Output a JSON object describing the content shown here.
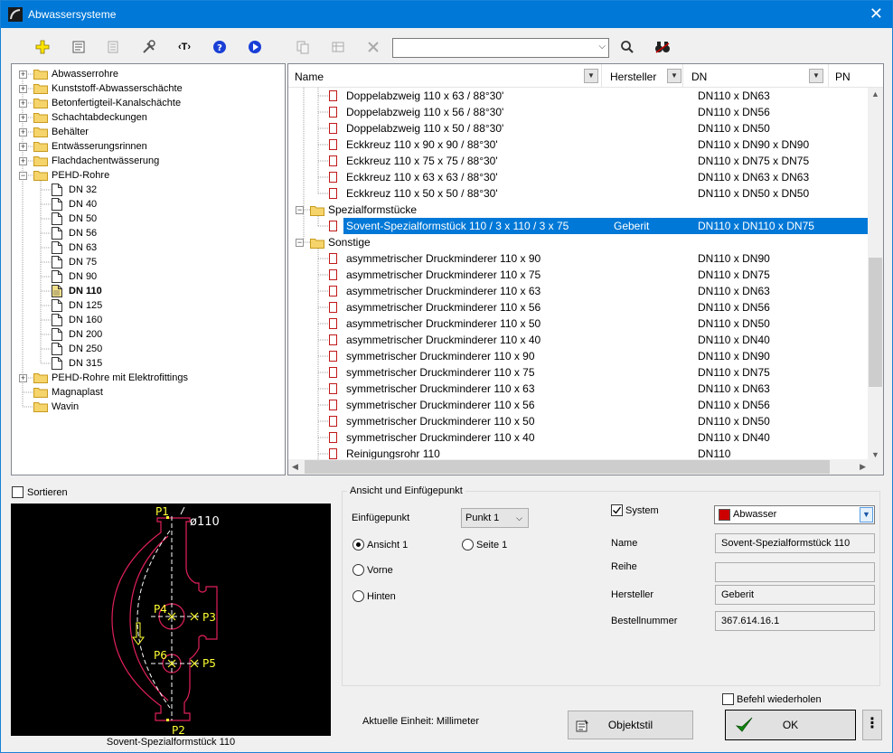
{
  "window": {
    "title": "Abwassersysteme",
    "close_icon": "close-icon"
  },
  "toolbar": {
    "search_value": "",
    "icons": [
      "add-icon",
      "properties-icon",
      "document-icon",
      "tools-icon",
      "text-tag-icon",
      "help-icon",
      "play-icon",
      "copy-icon",
      "table-icon",
      "delete-icon",
      "search-icon",
      "binoculars-icon"
    ]
  },
  "tree": {
    "items": [
      {
        "label": "Abwasserrohre"
      },
      {
        "label": "Kunststoff-Abwasserschächte"
      },
      {
        "label": "Betonfertigteil-Kanalschächte"
      },
      {
        "label": "Schachtabdeckungen"
      },
      {
        "label": "Behälter"
      },
      {
        "label": "Entwässerungsrinnen"
      },
      {
        "label": "Flachdachentwässerung"
      },
      {
        "label": "PEHD-Rohre"
      },
      {
        "label": "DN 32"
      },
      {
        "label": "DN 40"
      },
      {
        "label": "DN 50"
      },
      {
        "label": "DN 56"
      },
      {
        "label": "DN 63"
      },
      {
        "label": "DN 75"
      },
      {
        "label": "DN 90"
      },
      {
        "label": "DN 110"
      },
      {
        "label": "DN 125"
      },
      {
        "label": "DN 160"
      },
      {
        "label": "DN 200"
      },
      {
        "label": "DN 250"
      },
      {
        "label": "DN 315"
      },
      {
        "label": "PEHD-Rohre mit Elektrofittings"
      },
      {
        "label": "Magnaplast"
      },
      {
        "label": "Wavin"
      }
    ]
  },
  "grid": {
    "columns": [
      "Name",
      "Hersteller",
      "DN",
      "PN"
    ],
    "rows": [
      {
        "name": "Doppelabzweig 110 x 63 / 88°30'",
        "hersteller": "",
        "dn": "DN110 x DN63"
      },
      {
        "name": "Doppelabzweig 110 x 56 / 88°30'",
        "hersteller": "",
        "dn": "DN110 x DN56"
      },
      {
        "name": "Doppelabzweig 110 x 50 / 88°30'",
        "hersteller": "",
        "dn": "DN110 x DN50"
      },
      {
        "name": "Eckkreuz 110 x 90 x 90 / 88°30'",
        "hersteller": "",
        "dn": "DN110 x DN90 x DN90"
      },
      {
        "name": "Eckkreuz 110 x 75 x 75 / 88°30'",
        "hersteller": "",
        "dn": "DN110 x DN75 x DN75"
      },
      {
        "name": "Eckkreuz 110 x 63 x 63 / 88°30'",
        "hersteller": "",
        "dn": "DN110 x DN63 x DN63"
      },
      {
        "name": "Eckkreuz 110 x 50 x 50 / 88°30'",
        "hersteller": "",
        "dn": "DN110 x DN50 x DN50"
      },
      {
        "name": "Spezialformstücke",
        "hersteller": "",
        "dn": ""
      },
      {
        "name": "Sovent-Spezialformstück 110 / 3 x 110 / 3 x 75",
        "hersteller": "Geberit",
        "dn": "DN110 x DN110 x DN75"
      },
      {
        "name": "Sonstige",
        "hersteller": "",
        "dn": ""
      },
      {
        "name": "asymmetrischer Druckminderer 110 x 90",
        "hersteller": "",
        "dn": "DN110 x DN90"
      },
      {
        "name": "asymmetrischer Druckminderer 110 x 75",
        "hersteller": "",
        "dn": "DN110 x DN75"
      },
      {
        "name": "asymmetrischer Druckminderer 110 x 63",
        "hersteller": "",
        "dn": "DN110 x DN63"
      },
      {
        "name": "asymmetrischer Druckminderer 110 x 56",
        "hersteller": "",
        "dn": "DN110 x DN56"
      },
      {
        "name": "asymmetrischer Druckminderer 110 x 50",
        "hersteller": "",
        "dn": "DN110 x DN50"
      },
      {
        "name": "asymmetrischer Druckminderer 110 x 40",
        "hersteller": "",
        "dn": "DN110 x DN40"
      },
      {
        "name": "symmetrischer Druckminderer 110 x 90",
        "hersteller": "",
        "dn": "DN110 x DN90"
      },
      {
        "name": "symmetrischer Druckminderer 110 x 75",
        "hersteller": "",
        "dn": "DN110 x DN75"
      },
      {
        "name": "symmetrischer Druckminderer 110 x 63",
        "hersteller": "",
        "dn": "DN110 x DN63"
      },
      {
        "name": "symmetrischer Druckminderer 110 x 56",
        "hersteller": "",
        "dn": "DN110 x DN56"
      },
      {
        "name": "symmetrischer Druckminderer 110 x 50",
        "hersteller": "",
        "dn": "DN110 x DN50"
      },
      {
        "name": "symmetrischer Druckminderer 110 x 40",
        "hersteller": "",
        "dn": "DN110 x DN40"
      },
      {
        "name": "Reinigungsrohr 110",
        "hersteller": "",
        "dn": "DN110"
      }
    ]
  },
  "sort_label": "Sortieren",
  "preview": {
    "caption": "Sovent-Spezialformstück 110",
    "labels": {
      "p1": "P1",
      "p2": "P2",
      "p3": "P3",
      "p4": "P4",
      "p5": "P5",
      "p6": "P6",
      "dia": "ø110"
    }
  },
  "group": {
    "title": "Ansicht und Einfügepunkt",
    "insert_label": "Einfügepunkt",
    "insert_value": "Punkt 1",
    "radio_ansicht1": "Ansicht 1",
    "radio_seite1": "Seite 1",
    "radio_vorne": "Vorne",
    "radio_hinten": "Hinten",
    "system_label": "System",
    "system_value": "Abwasser",
    "system_color": "#cc0000",
    "name_label": "Name",
    "name_value": "Sovent-Spezialformstück 110",
    "reihe_label": "Reihe",
    "reihe_value": "",
    "hersteller_label": "Hersteller",
    "hersteller_value": "Geberit",
    "bestell_label": "Bestellnummer",
    "bestell_value": "367.614.16.1"
  },
  "footer": {
    "unit_text": "Aktuelle Einheit: Millimeter",
    "objektstil_label": "Objektstil",
    "ok_label": "OK",
    "repeat_label": "Befehl wiederholen"
  },
  "colors": {
    "selection": "#0078d7",
    "titlebar": "#0078d7"
  }
}
